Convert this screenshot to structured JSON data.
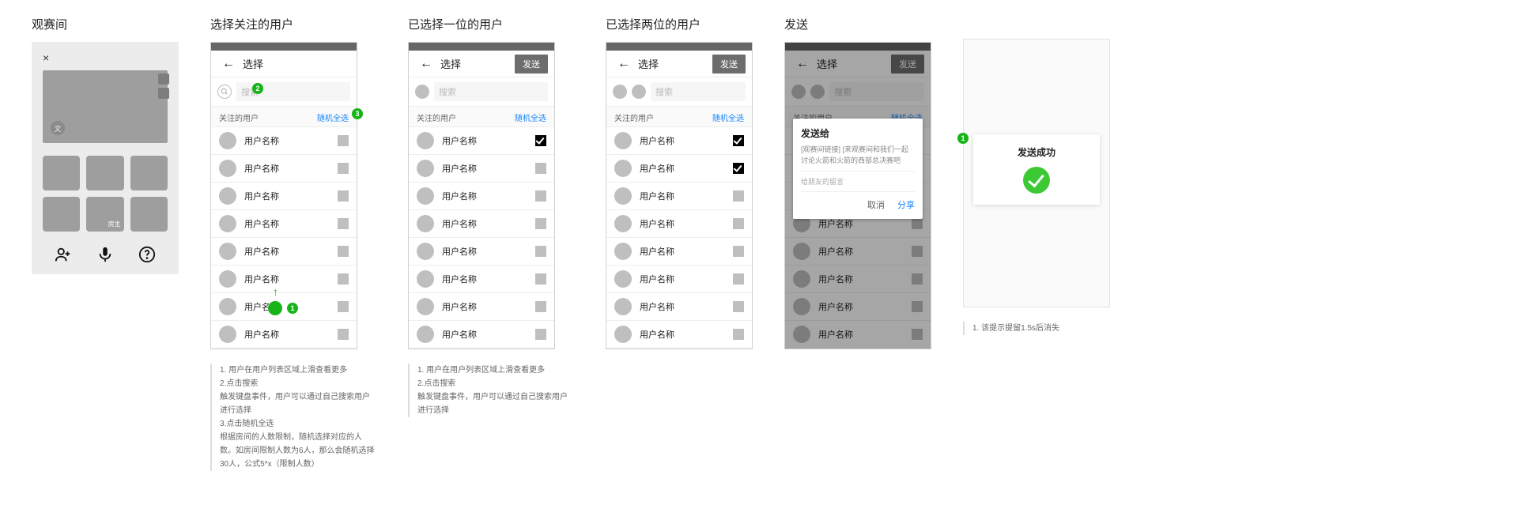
{
  "colors": {
    "accent_green": "#17b417",
    "link_blue": "#1684fc"
  },
  "room": {
    "title": "观赛间",
    "close": "×",
    "bubble": "文",
    "host_tag": "房主",
    "add_user_icon": "add-user-icon",
    "mic_icon": "mic-icon",
    "help_icon": "help-icon"
  },
  "select": {
    "header_title": "选择",
    "send_label": "发送",
    "back": "←",
    "search_placeholder": "搜索",
    "section_title": "关注的用户",
    "random_select": "随机全选",
    "username": "用户名称"
  },
  "titles": {
    "t2": "选择关注的用户",
    "t3": "已选择一位的用户",
    "t4": "已选择两位的用户",
    "t5": "发送"
  },
  "dialog": {
    "title": "发送给",
    "body": "[观赛间链接] [来观赛间和我们一起讨论火箭和火箭的西部总决赛吧",
    "placeholder": "给朋友的留言",
    "cancel": "取消",
    "share": "分享"
  },
  "toast": {
    "text": "发送成功"
  },
  "notes_a": [
    "1. 用户在用户列表区域上滑查看更多",
    "2.点击搜索",
    "触发键盘事件，用户可以通过自己搜索用户进行选择",
    "3.点击随机全选",
    "根据房间的人数限制，随机选择对应的人数。如房间限制人数为6人，那么会随机选择30人，公式5*x（限制人数）"
  ],
  "notes_b": [
    "1. 用户在用户列表区域上滑查看更多",
    "2.点击搜索",
    "触发键盘事件，用户可以通过自己搜索用户进行选择"
  ],
  "notes_c": [
    "1. 该提示提留1.5s后消失"
  ],
  "anno": {
    "n1": "1",
    "n2": "2",
    "n3": "3"
  }
}
